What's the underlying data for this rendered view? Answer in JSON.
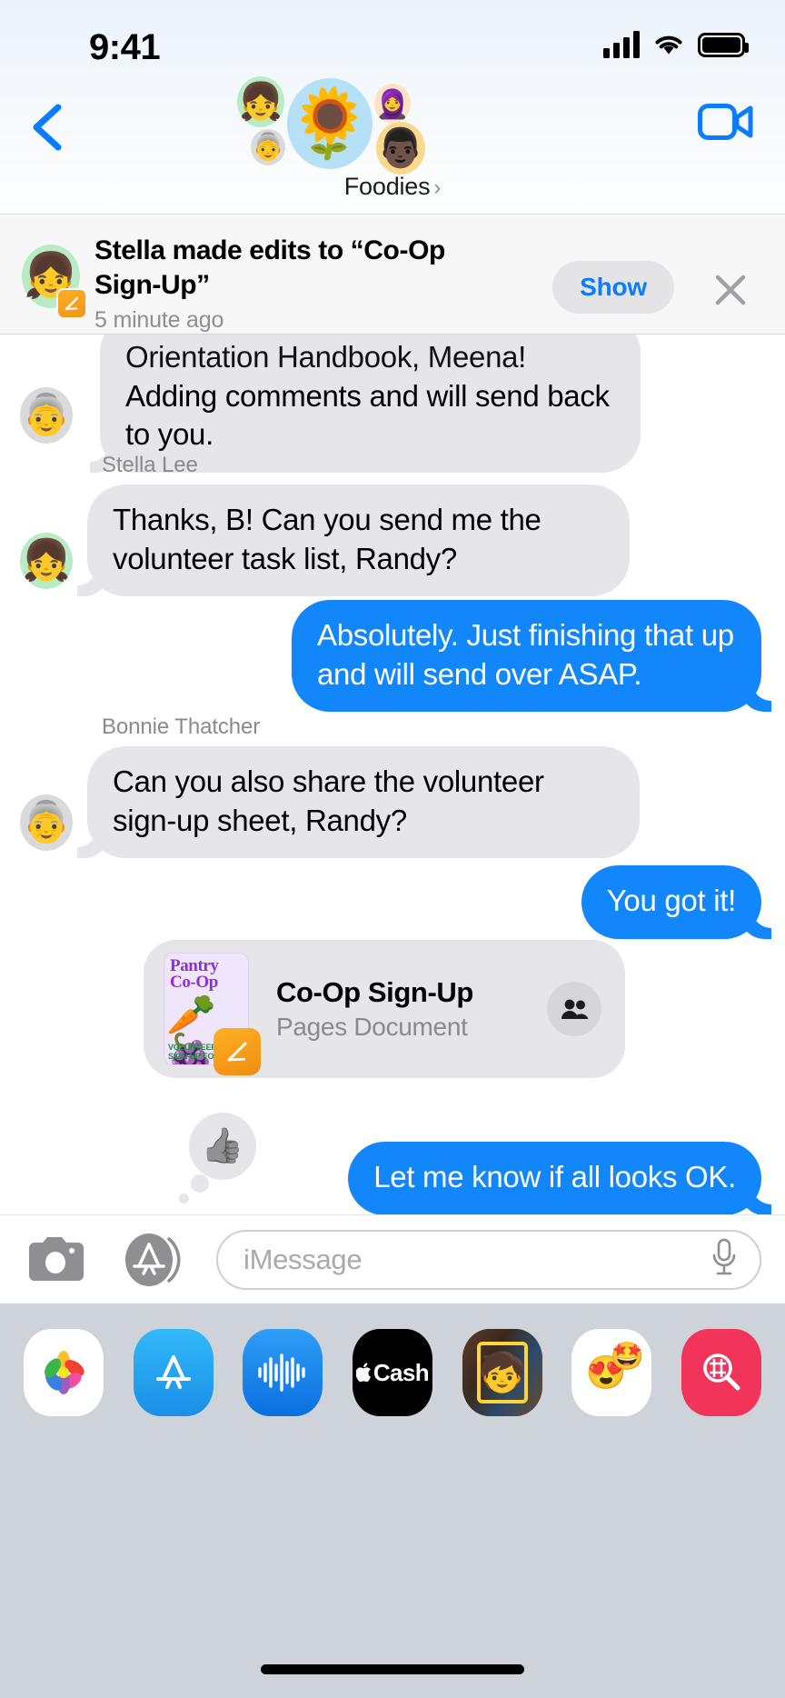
{
  "status_bar": {
    "time": "9:41",
    "cellular_icon": "cellular-bars-icon",
    "wifi_icon": "wifi-icon",
    "battery_icon": "battery-full-icon"
  },
  "nav": {
    "back_icon": "back-chevron-icon",
    "facetime_icon": "facetime-video-icon",
    "group_name": "Foodies",
    "group_chevron": "›",
    "avatars": [
      {
        "name": "group-avatar-main",
        "glyph": "🌻",
        "bg": "#b6e0f5"
      },
      {
        "name": "group-avatar-stella",
        "glyph": "👧",
        "bg": "#b9ecc5"
      },
      {
        "name": "group-avatar-bonnie",
        "glyph": "👵",
        "bg": "#dadada"
      },
      {
        "name": "group-avatar-meena",
        "glyph": "🧕",
        "bg": "#fde3c6"
      },
      {
        "name": "group-avatar-randy",
        "glyph": "👨🏿",
        "bg": "#fbd98c"
      }
    ]
  },
  "banner": {
    "avatar_glyph": "👧",
    "badge_icon": "pages-app-icon",
    "title": "Stella made edits to “Co-Op Sign-Up”",
    "timestamp": "5 minute ago",
    "show_label": "Show",
    "close_icon": "close-x-icon",
    "accent_color": "#0a7cff"
  },
  "conversation": {
    "messages": [
      {
        "id": "msg-handbook",
        "side": "in",
        "sender": "",
        "avatar_glyph": "👵",
        "avatar_bg": "#dadada",
        "clipped_line": "Orientation Handbook, Meena!",
        "text": "Adding comments and will send back to you.",
        "clipped": true
      },
      {
        "id": "msg-thanks-b",
        "side": "in",
        "sender": "Stella Lee",
        "avatar_glyph": "👧",
        "avatar_bg": "#b9ecc5",
        "text": "Thanks, B! Can you send me the volunteer task list, Randy?"
      },
      {
        "id": "msg-absolutely",
        "side": "out",
        "text": "Absolutely. Just finishing that up and will send over ASAP."
      },
      {
        "id": "msg-share-sheet",
        "side": "in",
        "sender": "Bonnie Thatcher",
        "avatar_glyph": "👵",
        "avatar_bg": "#dadada",
        "text": "Can you also share the volunteer sign-up sheet, Randy?"
      },
      {
        "id": "msg-you-got-it",
        "side": "out",
        "text": "You got it!"
      },
      {
        "id": "msg-let-me-know",
        "side": "out",
        "text": "Let me know if all looks OK.",
        "tapback": "👍"
      }
    ],
    "attachment": {
      "id": "attachment-co-op-sign-up",
      "name": "Co-Op Sign-Up",
      "type": "Pages Document",
      "collab_icon": "collaborators-icon",
      "thumbnail": {
        "title_line1": "Pantry",
        "title_line2": "Co-Op",
        "art_glyph": "🥕",
        "footer_line1": "VOLUNTEER",
        "footer_line2": "SIGN-UP FORM",
        "badge_icon": "pages-app-icon"
      }
    }
  },
  "input_bar": {
    "camera_icon": "camera-icon",
    "appstore_icon": "app-store-icon",
    "placeholder": "iMessage",
    "mic_icon": "microphone-icon"
  },
  "app_drawer": {
    "apps": [
      {
        "name": "app-photos",
        "label": "Photos"
      },
      {
        "name": "app-store",
        "label": "App Store"
      },
      {
        "name": "app-voice-memo",
        "label": "Audio"
      },
      {
        "name": "app-apple-cash",
        "label": "Apple Cash"
      },
      {
        "name": "app-memoji-camera",
        "label": "Memoji"
      },
      {
        "name": "app-memoji-stickers",
        "label": "Memoji Stickers"
      },
      {
        "name": "app-images",
        "label": "#images"
      }
    ],
    "apple_cash_label": "Cash",
    "home_indicator": "home-indicator"
  },
  "colors": {
    "imessage_blue": "#1287fb",
    "bubble_gray": "#e5e5ea",
    "accent_blue": "#0a7cff",
    "drawer_bg": "#ced2d9"
  }
}
